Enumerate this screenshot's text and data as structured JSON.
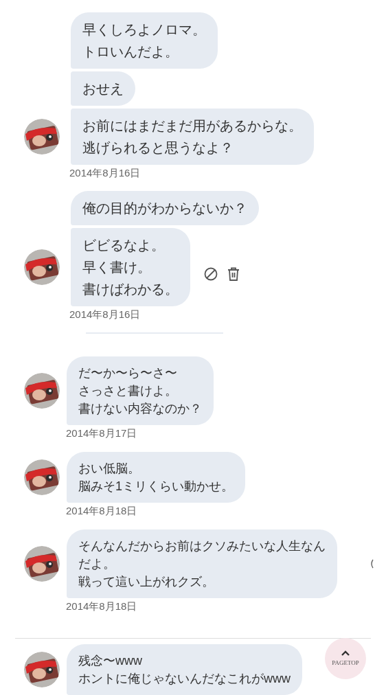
{
  "sections": [
    {
      "groups": [
        {
          "messages": [
            [
              "早くしろよノロマ。",
              "トロいんだよ。"
            ],
            [
              "おせえ"
            ],
            [
              "お前にはまだまだ用があるからな。",
              "逃げられると思うなよ？"
            ]
          ],
          "date": "2014年8月16日",
          "show_actions": false
        },
        {
          "messages": [
            [
              "俺の目的がわからないか？"
            ],
            [
              "ビビるなよ。",
              "早く書け。",
              "書けばわかる。"
            ]
          ],
          "date": "2014年8月16日",
          "show_actions": true
        }
      ]
    },
    {
      "groups": [
        {
          "messages": [
            [
              "だ〜か〜ら〜さ〜",
              "さっさと書けよ。",
              "書けない内容なのか？"
            ]
          ],
          "date": "2014年8月17日",
          "show_actions": false
        },
        {
          "messages": [
            [
              "おい低脳。",
              "脳みそ1ミリくらい動かせ。"
            ]
          ],
          "date": "2014年8月18日",
          "show_actions": false
        },
        {
          "messages": [
            [
              "そんなんだからお前はクソみたいな人生なん",
              "だよ。",
              "戦って這い上がれクズ。"
            ]
          ],
          "date": "2014年8月18日",
          "show_actions": false
        }
      ]
    },
    {
      "groups": [
        {
          "messages": [
            [
              "残念〜www",
              "ホントに俺じゃないんだなこれがwww"
            ]
          ],
          "show_actions": false
        }
      ]
    }
  ],
  "page_top": {
    "label": "PAGETOP"
  }
}
